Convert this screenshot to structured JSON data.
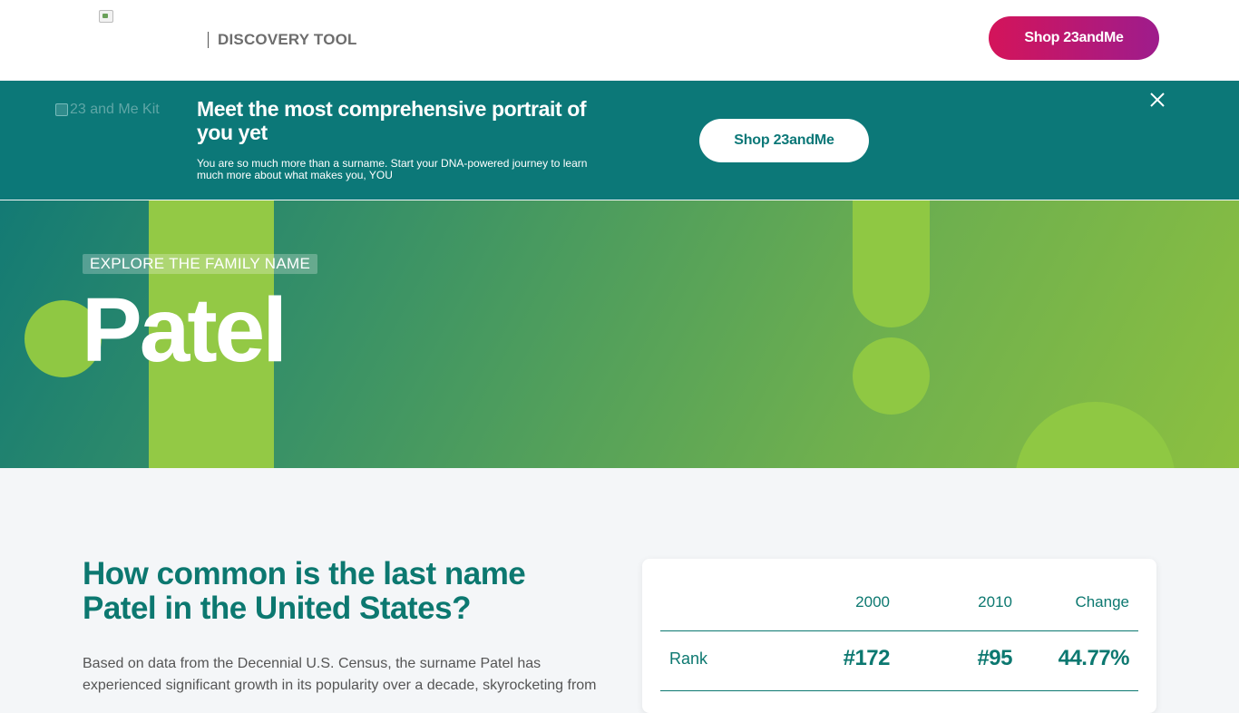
{
  "header": {
    "logo_alt": "",
    "tool_name": "DISCOVERY TOOL",
    "shop_button": "Shop 23andMe"
  },
  "banner": {
    "image_alt": "23 and Me Kit",
    "title": "Meet the most comprehensive portrait of you yet",
    "description": "You are so much more than a surname. Start your DNA-powered journey to learn much more about what makes you, YOU",
    "shop_button": "Shop 23andMe",
    "close_icon": "close-icon"
  },
  "hero": {
    "eyebrow": "EXPLORE THE FAMILY NAME",
    "surname": "Patel"
  },
  "section": {
    "title": "How common is the last name Patel in the United States?",
    "text": "Based on data from the Decennial U.S. Census, the surname Patel has experienced significant growth in its popularity over a decade, skyrocketing from"
  },
  "stats": {
    "headers": [
      "2000",
      "2010",
      "Change"
    ],
    "rows": [
      {
        "label": "Rank",
        "values": [
          "#172",
          "#95",
          "44.77%"
        ]
      }
    ]
  },
  "colors": {
    "brand_teal": "#0c7878",
    "shop_gradient_start": "#d4145a",
    "shop_gradient_end": "#9e1c8c",
    "accent_green": "#8fc843"
  }
}
